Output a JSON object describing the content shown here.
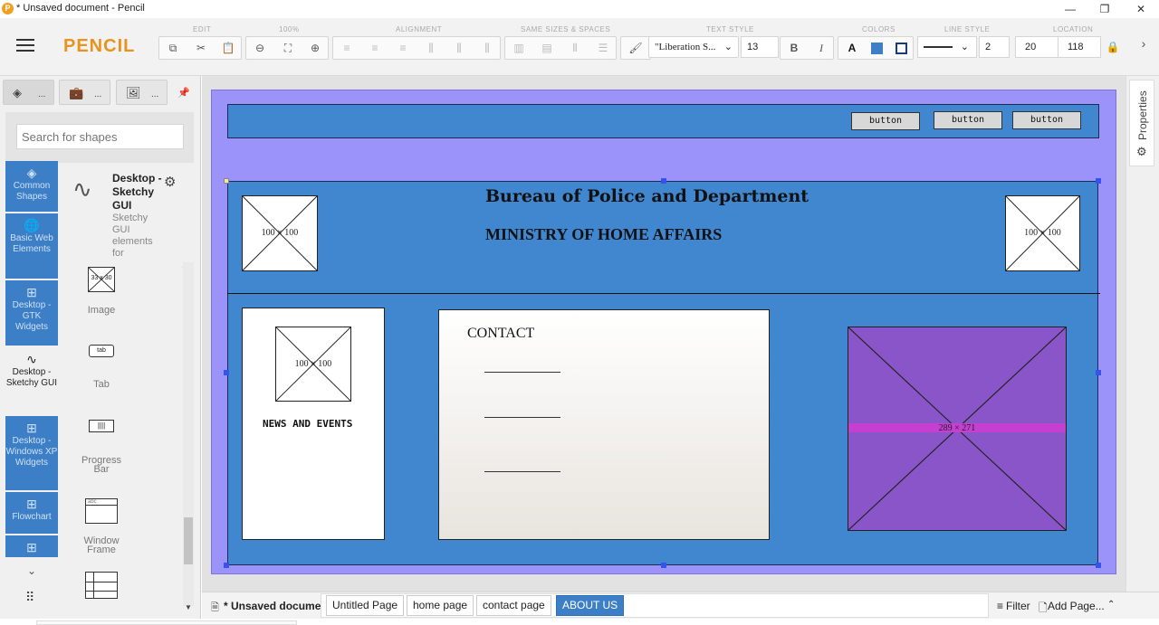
{
  "window": {
    "title": "* Unsaved document - Pencil",
    "app_icon": "P",
    "minimize": "—",
    "maximize": "❐",
    "close": "✕"
  },
  "toolbar": {
    "logo": "PENCIL",
    "groups": {
      "edit": "EDIT",
      "zoom": "100%",
      "alignment": "ALIGNMENT",
      "same_sizes": "SAME SIZES & SPACES",
      "text_style": "TEXT STYLE",
      "colors": "COLORS",
      "line_style": "LINE STYLE",
      "location": "LOCATION"
    },
    "font_name": "\"Liberation S...",
    "font_size": "13",
    "bold": "B",
    "italic": "I",
    "text_color": "A",
    "line_width": "2",
    "loc_x": "20",
    "loc_y": "118"
  },
  "left_panel": {
    "tab_dots": "...",
    "search_placeholder": "Search for shapes",
    "categories": [
      {
        "label": "Common Shapes",
        "icon": "layers-icon"
      },
      {
        "label": "Basic Web Elements",
        "icon": "globe-icon"
      },
      {
        "label": "Desktop - GTK Widgets",
        "icon": "grid-icon"
      },
      {
        "label": "Desktop - Sketchy GUI",
        "icon": "squiggle-icon"
      },
      {
        "label": "Desktop - Windows XP Widgets",
        "icon": "grid-icon"
      },
      {
        "label": "Flowchart",
        "icon": "grid-icon"
      }
    ],
    "library": {
      "title": "Desktop - Sketchy GUI",
      "description": "Sketchy GUI elements for"
    },
    "shapes": [
      {
        "label": "Image",
        "thumb": "33 x 30"
      },
      {
        "label": "Tab",
        "thumb": "tab"
      },
      {
        "label": "Progress Bar",
        "thumb": ""
      },
      {
        "label": "Window Frame",
        "thumb": "abc"
      }
    ]
  },
  "canvas": {
    "header_buttons": [
      "button",
      "button",
      "button"
    ],
    "title": "Bureau of Police and Department",
    "subtitle": "MINISTRY OF HOME AFFAIRS",
    "logo_left": "100 × 100",
    "logo_right": "100 × 100",
    "news_image": "100 × 100",
    "news_label": "NEWS AND EVENTS",
    "contact_label": "CONTACT",
    "big_image": "289 × 271"
  },
  "right_panel": {
    "properties_label": "Properties"
  },
  "bottom": {
    "doc_name": "* Unsaved document",
    "pages": [
      "Untitled Page",
      "home page",
      "contact page",
      "ABOUT US"
    ],
    "filter": "Filter",
    "add_page": "Add Page..."
  },
  "colors": {
    "page_bg": "#9b93f9",
    "blue_panel": "#4087cf",
    "purple_image": "#8a55c8",
    "accent": "#3d7fc6",
    "logo": "#e8931e"
  }
}
